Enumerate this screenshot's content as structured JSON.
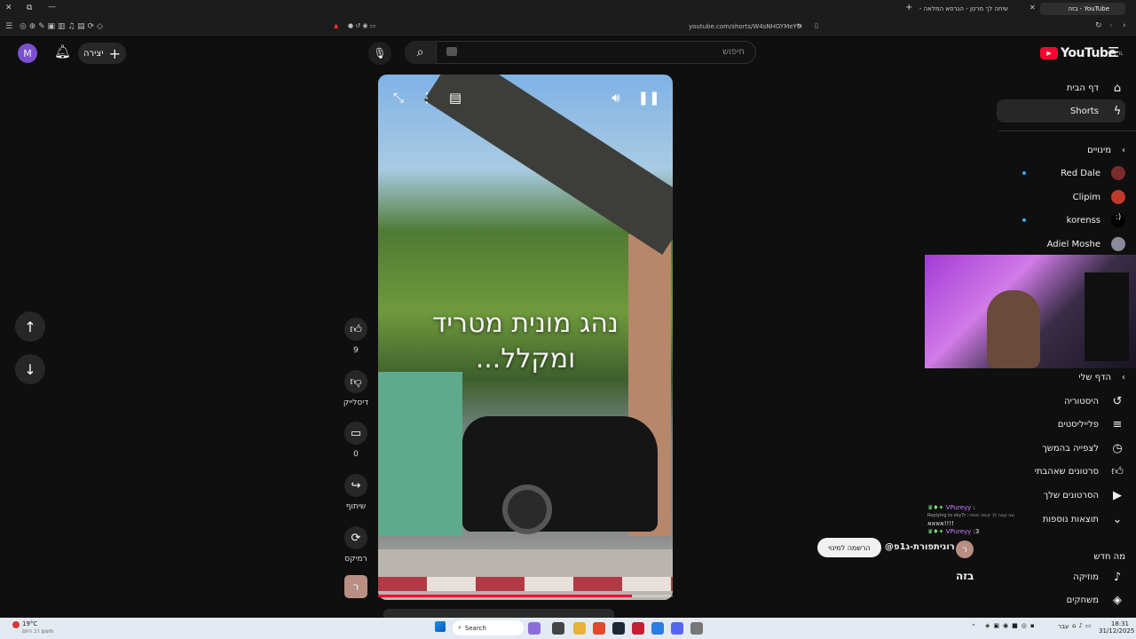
{
  "browser": {
    "tabs": [
      {
        "label": "YouTube - בזה",
        "active": true
      },
      {
        "label": "שיחה לך מרטן - הגרסא המלאה - e",
        "active": false
      }
    ],
    "url": "youtube.com/shorts/W4sNHGYMeY0"
  },
  "header": {
    "logo_text": "YouTube",
    "logo_sup": "IL",
    "search_placeholder": "חיפוש",
    "create_label": "יצירה",
    "avatar_letter": "M"
  },
  "video": {
    "caption_line1": "נהג מונית מטריד",
    "caption_line2": "ומקלל...",
    "progress": 0.86
  },
  "actions": {
    "likes": "9",
    "dislike_label": "דיסלייק",
    "comments": "0",
    "share_label": "שיתוף",
    "remix_label": "רמיקס",
    "channel_letter": "ר"
  },
  "channel": {
    "handle": "@רונית‌פורת-ג1פ",
    "subscribe_label": "הרשמה למינוי",
    "title": "בזה"
  },
  "sidebar": {
    "home": "דף הבית",
    "shorts": "Shorts",
    "subs_header": "מינויים",
    "subs": [
      {
        "name": "Red Dale",
        "dot": true,
        "color": "#7a2b2b"
      },
      {
        "name": "Clipim",
        "dot": false,
        "color": "#c0392b"
      },
      {
        "name": "korenss",
        "dot": true,
        "color": "#000000"
      },
      {
        "name": "Adiel Moshe",
        "dot": false,
        "color": "#8a8a9a"
      }
    ],
    "you_header": "הדף שלי",
    "you_items": [
      "היסטוריה",
      "פלייליסטים",
      "לצפייה בהמשך",
      "סרטונים שאהבתי",
      "הסרטונים שלך",
      "תוצאות נוספות"
    ],
    "explore_header": "מה חדש",
    "explore_items": [
      "מוזיקה",
      "משחקים"
    ]
  },
  "chat": {
    "user": "VPureyy",
    "reply": "Replying to sky7r :אני קונה לך קופה פיתרי",
    "msg1": "אאאא!!!!",
    "msg2": ":3"
  },
  "taskbar": {
    "weather": "19°C",
    "weather_sub": "מעונן רב היום",
    "search": "Search",
    "lang": "עבר",
    "time": "18:31",
    "date": "31/12/2025"
  },
  "colors": {
    "accent": "#ff0033",
    "dot": "#3ea6ff"
  }
}
